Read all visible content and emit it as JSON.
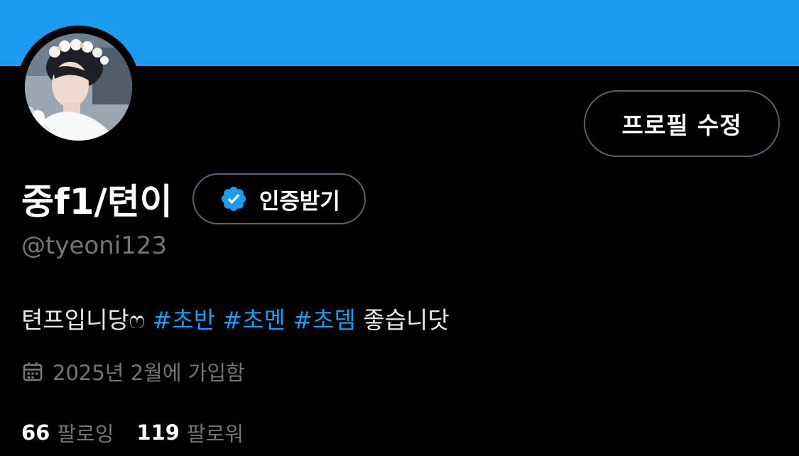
{
  "colors": {
    "banner": "#1d9bf0",
    "background": "#000000",
    "accent": "#1d9bf0",
    "muted": "#71767b",
    "border": "#536471"
  },
  "header": {
    "edit_profile_label": "프로필 수정"
  },
  "profile": {
    "avatar_icon": "profile-photo",
    "display_name": "중f1/텬이",
    "verify_label": "인증받기",
    "verify_icon": "verified-badge-icon",
    "handle": "@tyeoni123",
    "bio": {
      "prefix": "텬프입니당ෆ",
      "tags": [
        "#초반",
        "#초멘",
        "#초뎀"
      ],
      "suffix": "좋습니닷"
    },
    "joined_icon": "calendar-icon",
    "joined": "2025년 2월에 가입함"
  },
  "stats": {
    "following_count": "66",
    "following_label": "팔로잉",
    "followers_count": "119",
    "followers_label": "팔로워"
  }
}
